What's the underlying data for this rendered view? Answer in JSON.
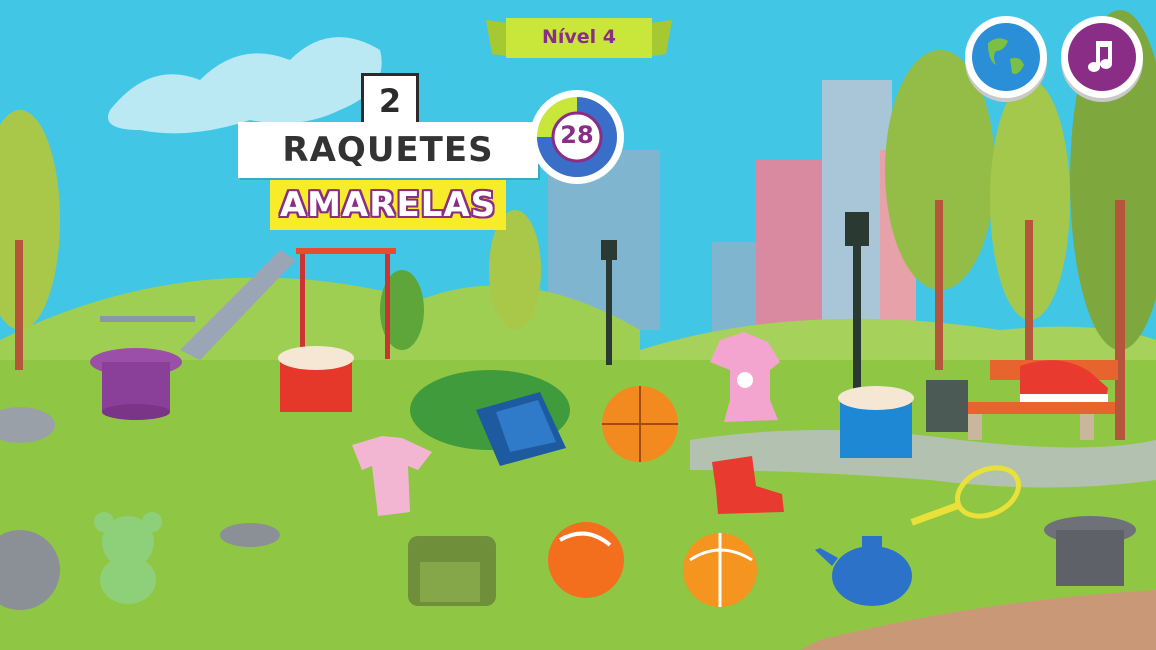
{
  "level": {
    "label": "Nível 4"
  },
  "task": {
    "count": "2",
    "item": "RAQUETES",
    "color": "AMARELAS"
  },
  "timer": {
    "seconds": "28",
    "remaining_fraction": 0.75
  },
  "buttons": {
    "language_icon": "globe-icon",
    "music_icon": "music-note-icon"
  },
  "colors": {
    "accent_purple": "#8a2d86",
    "banner_green": "#c9e63a",
    "highlight_yellow": "#f6ec2a",
    "sky": "#42c6e6",
    "grass": "#8fc744"
  },
  "items": [
    {
      "name": "purple-top-hat"
    },
    {
      "name": "red-drum"
    },
    {
      "name": "pink-shirt"
    },
    {
      "name": "blue-book"
    },
    {
      "name": "orange-basketball"
    },
    {
      "name": "pink-dress"
    },
    {
      "name": "blue-drum"
    },
    {
      "name": "red-sneaker"
    },
    {
      "name": "red-boot"
    },
    {
      "name": "yellow-tennis-racket"
    },
    {
      "name": "green-teddy-bear"
    },
    {
      "name": "green-backpack"
    },
    {
      "name": "orange-beach-ball"
    },
    {
      "name": "orange-volleyball"
    },
    {
      "name": "blue-teapot"
    },
    {
      "name": "gray-top-hat"
    }
  ]
}
